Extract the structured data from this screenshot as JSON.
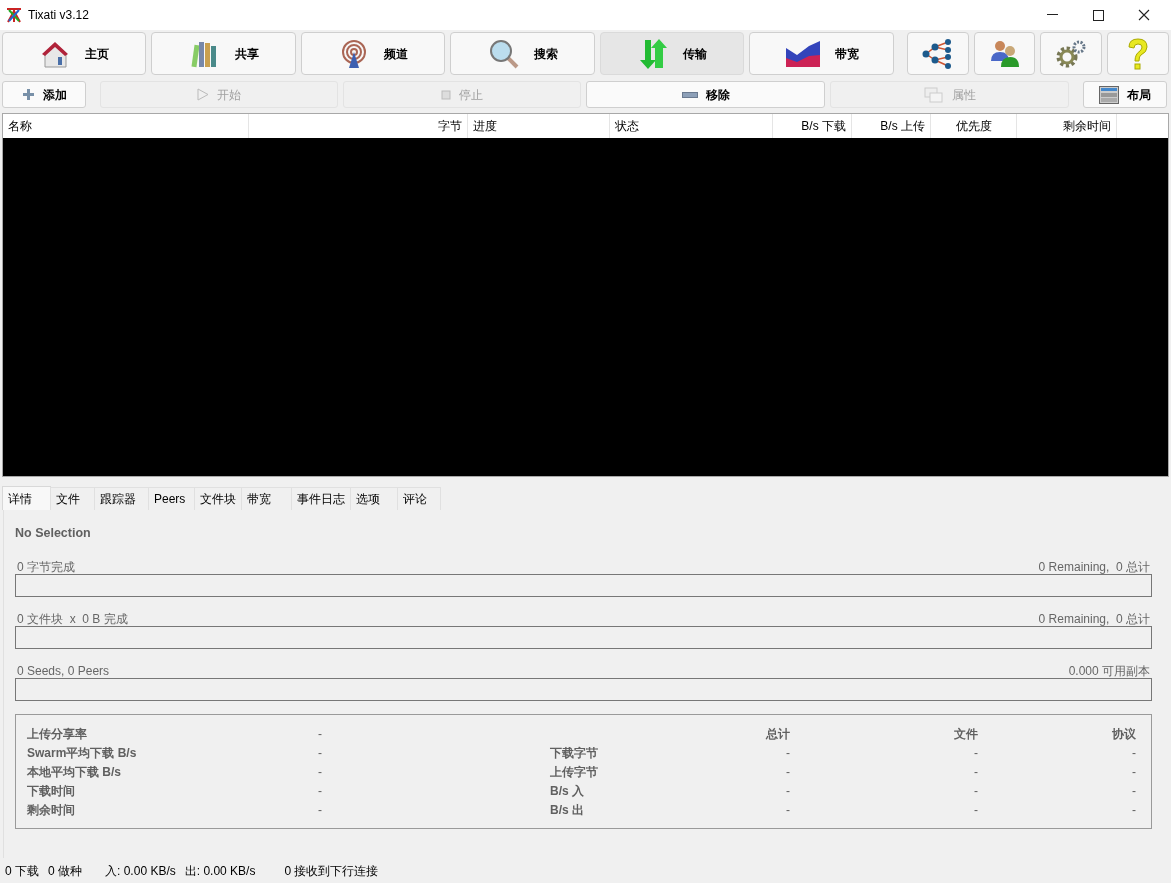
{
  "window": {
    "title": "Tixati v3.12"
  },
  "main_buttons": [
    {
      "label": "主页",
      "selected": false
    },
    {
      "label": "共享",
      "selected": false
    },
    {
      "label": "频道",
      "selected": false
    },
    {
      "label": "搜索",
      "selected": false
    },
    {
      "label": "传输",
      "selected": true
    },
    {
      "label": "带宽",
      "selected": false
    }
  ],
  "action_buttons": [
    {
      "label": "添加",
      "disabled": false
    },
    {
      "label": "开始",
      "disabled": true
    },
    {
      "label": "停止",
      "disabled": true
    },
    {
      "label": "移除",
      "disabled": false
    },
    {
      "label": "属性",
      "disabled": true
    },
    {
      "label": "布局",
      "disabled": false
    }
  ],
  "table": {
    "columns": [
      "名称",
      "字节",
      "进度",
      "状态",
      "B/s 下载",
      "B/s 上传",
      "优先度",
      "剩余时间"
    ]
  },
  "tabs": [
    {
      "label": "详情",
      "selected": true
    },
    {
      "label": "文件",
      "selected": false
    },
    {
      "label": "跟踪器",
      "selected": false
    },
    {
      "label": "Peers",
      "selected": false
    },
    {
      "label": "文件块",
      "selected": false
    },
    {
      "label": "带宽",
      "selected": false
    },
    {
      "label": "事件日志",
      "selected": false
    },
    {
      "label": "选项",
      "selected": false
    },
    {
      "label": "评论",
      "selected": false
    }
  ],
  "details": {
    "heading": "No Selection",
    "bars": [
      {
        "left": "0 字节完成",
        "right": "0 Remaining,  0 总计",
        "level": 0
      },
      {
        "left": "0 文件块  x  0 B 完成",
        "right": "0 Remaining,  0 总计",
        "level": 0
      },
      {
        "left": "0 Seeds, 0 Peers",
        "right": "0.000 可用副本",
        "level": 0
      }
    ],
    "stats": {
      "left": [
        {
          "label": "上传分享率",
          "value": "-"
        },
        {
          "label": "Swarm平均下载 B/s",
          "value": "-"
        },
        {
          "label": "本地平均下载 B/s",
          "value": "-"
        },
        {
          "label": "下载时间",
          "value": "-"
        },
        {
          "label": "剩余时间",
          "value": "-"
        }
      ],
      "columns": [
        "总计",
        "文件",
        "协议"
      ],
      "rows": [
        {
          "label": "下载字节",
          "values": [
            "-",
            "-",
            "-"
          ]
        },
        {
          "label": "上传字节",
          "values": [
            "-",
            "-",
            "-"
          ]
        },
        {
          "label": "B/s 入",
          "values": [
            "-",
            "-",
            "-"
          ]
        },
        {
          "label": "B/s 出",
          "values": [
            "-",
            "-",
            "-"
          ]
        }
      ]
    }
  },
  "status_bar": [
    "0 下载",
    "0 做种",
    "入: 0.00 KB/s",
    "出: 0.00 KB/s",
    "0 接收到下行连接"
  ]
}
